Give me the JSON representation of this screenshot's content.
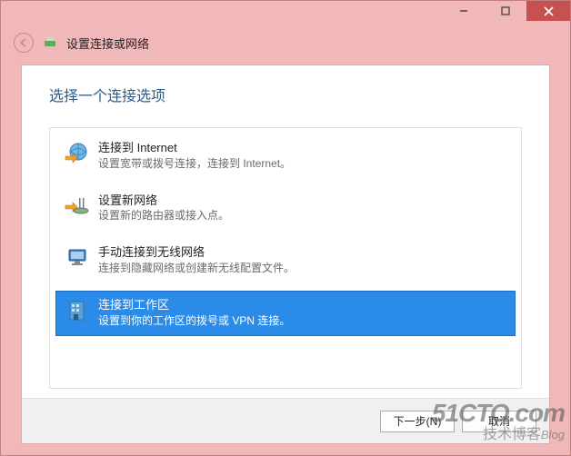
{
  "window": {
    "title": "设置连接或网络"
  },
  "heading": "选择一个连接选项",
  "options": [
    {
      "title": "连接到 Internet",
      "subtitle": "设置宽带或拨号连接，连接到 Internet。",
      "icon": "globe-arrow-icon",
      "selected": false
    },
    {
      "title": "设置新网络",
      "subtitle": "设置新的路由器或接入点。",
      "icon": "router-icon",
      "selected": false
    },
    {
      "title": "手动连接到无线网络",
      "subtitle": "连接到隐藏网络或创建新无线配置文件。",
      "icon": "monitor-icon",
      "selected": false
    },
    {
      "title": "连接到工作区",
      "subtitle": "设置到你的工作区的拨号或 VPN 连接。",
      "icon": "building-icon",
      "selected": true
    }
  ],
  "footer": {
    "next": "下一步(N)",
    "cancel": "取消"
  },
  "watermark": {
    "line1": "51CTO.com",
    "line2_cn": "技术博客",
    "line2_en": "Blog"
  }
}
